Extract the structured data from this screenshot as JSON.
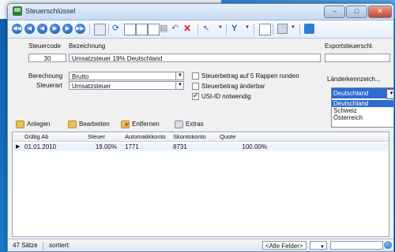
{
  "window": {
    "title": "Steuerschlüssel"
  },
  "form": {
    "steuercode_label": "Steuercode",
    "steuercode_value": "30",
    "bezeichnung_label": "Bezeichnung",
    "bezeichnung_value": "Umsatzsteuer 19% Deutschland",
    "exportsteuerschl_label": "Exportsteuerschl.",
    "exportsteuerschl_value": "",
    "berechnung_label": "Berechnung",
    "berechnung_value": "Brutto",
    "steuerart_label": "Steuerart",
    "steuerart_value": "Umsatzsteuer",
    "cb1_label": "Steuerbetrag auf 5 Rappen runden",
    "cb2_label": "Steuerbetrag änderbar",
    "cb3_label": "USt-ID notwendig",
    "laender_label": "Länderkennzeich...",
    "laender_selected": "Deutschland",
    "laender_options": [
      "Deutschland",
      "Schweiz",
      "Österreich"
    ]
  },
  "actions": {
    "anlegen": "Anlegen",
    "bearbeiten": "Bearbeiten",
    "entfernen": "Entfernen",
    "extras": "Extras"
  },
  "table": {
    "headers": [
      "Gültig Ab",
      "Steuer",
      "Automatikkonto",
      "Skontokonto",
      "Quote"
    ],
    "rows": [
      [
        "01.01.2010",
        "19.00%",
        "1771",
        "8731",
        "100.00%"
      ]
    ]
  },
  "status": {
    "count": "47 Sätze",
    "sort": "sortiert:",
    "filter": "<Alle Felder>"
  },
  "colors": {
    "selection": "#2f6bd0",
    "desktop_blue": "#1b7ed1"
  }
}
